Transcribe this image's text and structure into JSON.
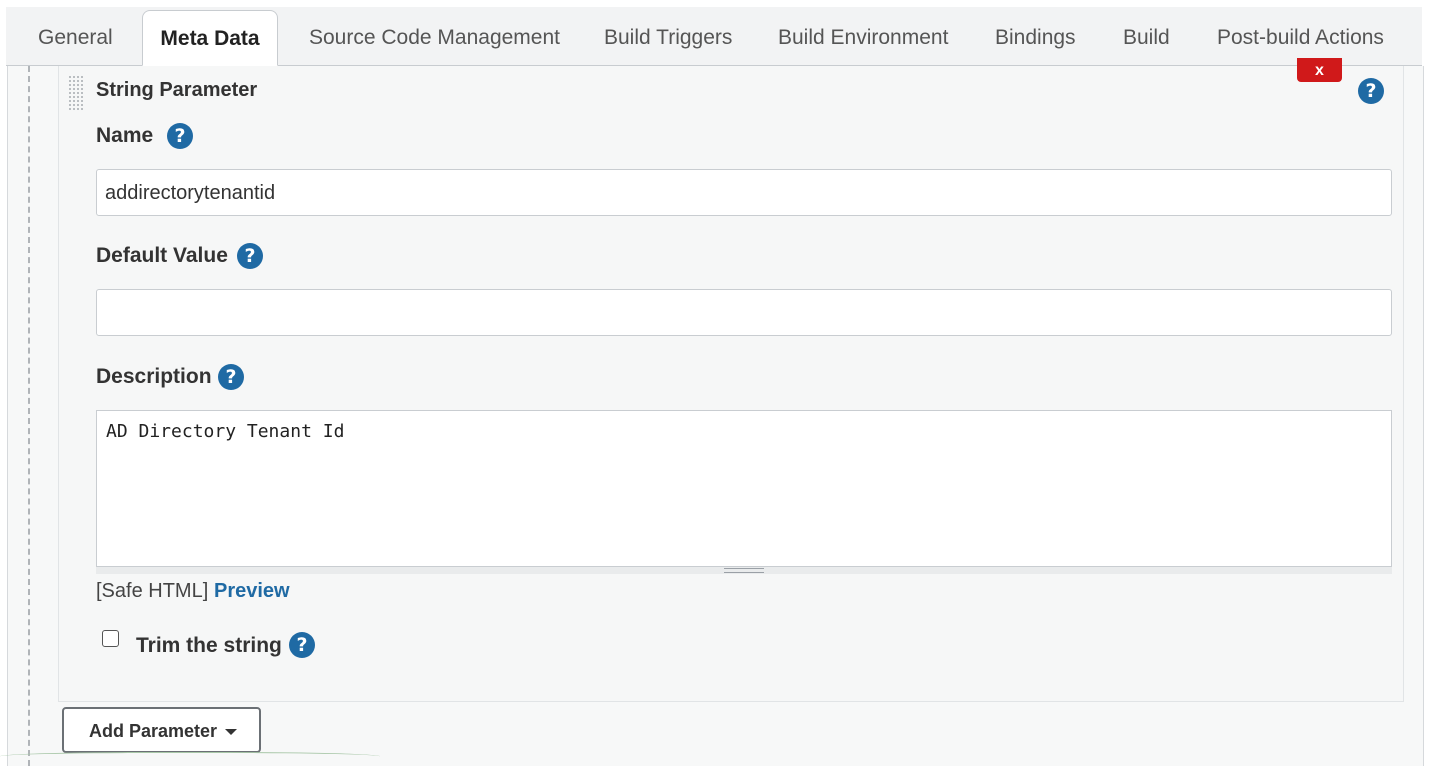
{
  "tabs": [
    {
      "label": "General",
      "active": false
    },
    {
      "label": "Meta Data",
      "active": true
    },
    {
      "label": "Source Code Management",
      "active": false
    },
    {
      "label": "Build Triggers",
      "active": false
    },
    {
      "label": "Build Environment",
      "active": false
    },
    {
      "label": "Bindings",
      "active": false
    },
    {
      "label": "Build",
      "active": false
    },
    {
      "label": "Post-build Actions",
      "active": false
    }
  ],
  "parameter": {
    "title": "String Parameter",
    "delete_label": "x",
    "name_label": "Name",
    "name_value": "addirectorytenantid",
    "default_label": "Default Value",
    "default_value": "",
    "description_label": "Description",
    "description_value": "AD Directory Tenant Id",
    "safe_html": "[Safe HTML]",
    "preview_label": "Preview",
    "trim_label": "Trim the string",
    "trim_checked": false
  },
  "help_glyph": "?",
  "add_parameter_label": "Add Parameter",
  "colors": {
    "help": "#1f6aa4",
    "delete": "#d0191a",
    "link": "#1f6aa4"
  },
  "icons": [
    "help-icon",
    "drag-handle-icon",
    "caret-down-icon"
  ]
}
